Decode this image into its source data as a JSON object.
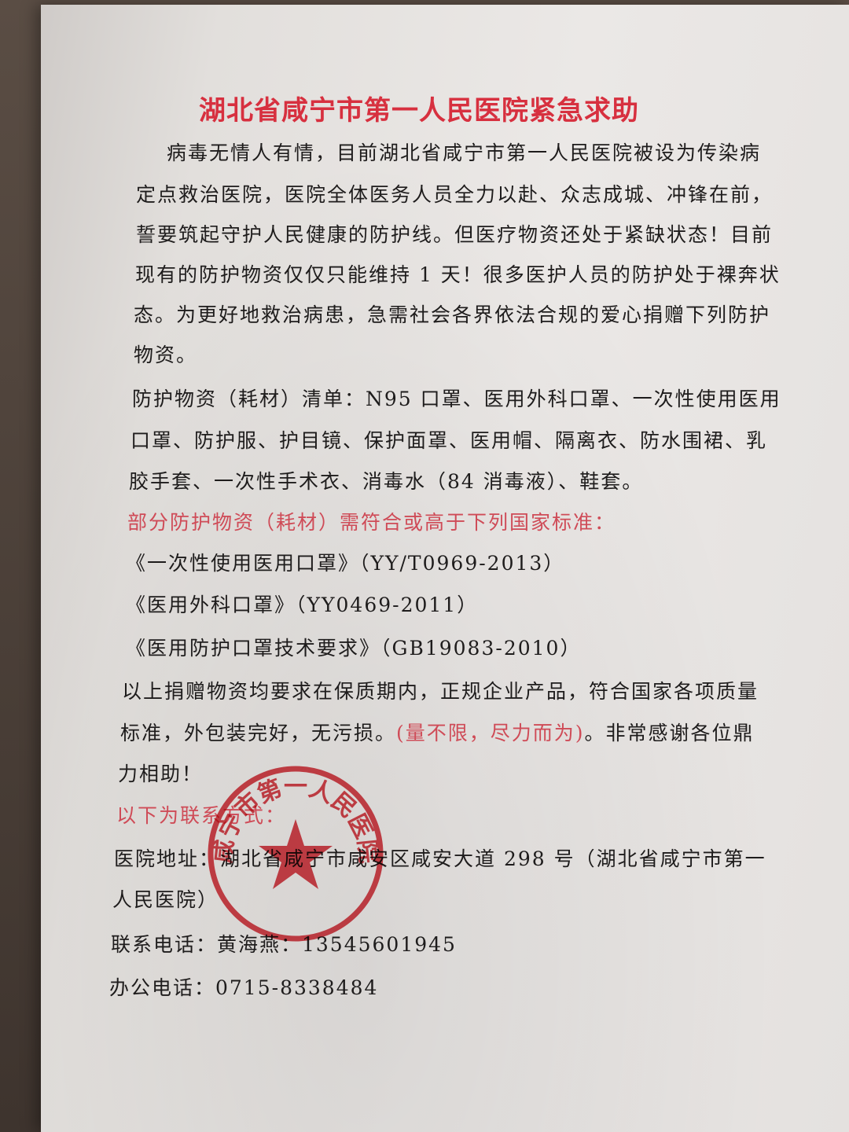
{
  "document": {
    "title": "湖北省咸宁市第一人民医院紧急求助",
    "intro_lines": [
      "病毒无情人有情，目前湖北省咸宁市第一人民医院被设为传染病",
      "定点救治医院，医院全体医务人员全力以赴、众志成城、冲锋在前，",
      "誓要筑起守护人民健康的防护线。但医疗物资还处于紧缺状态！目前",
      "现有的防护物资仅仅只能维持 1 天！很多医护人员的防护处于裸奔状",
      "态。为更好地救治病患，急需社会各界依法合规的爱心捐赠下列防护",
      "物资。"
    ],
    "list_lines": [
      "防护物资（耗材）清单：N95 口罩、医用外科口罩、一次性使用医用",
      "口罩、防护服、护目镜、保护面罩、医用帽、隔离衣、防水围裙、乳",
      "胶手套、一次性手术衣、消毒水（84 消毒液）、鞋套。"
    ],
    "standards_heading": "部分防护物资（耗材）需符合或高于下列国家标准：",
    "standards": [
      "《一次性使用医用口罩》（YY/T0969-2013）",
      "《医用外科口罩》（YY0469-2011）",
      "《医用防护口罩技术要求》（GB19083-2010）"
    ],
    "requirements_line1": "以上捐赠物资均要求在保质期内，正规企业产品，符合国家各项质量",
    "requirements_line2_a": "标准，外包装完好，无污损。",
    "requirements_line2_b": "(量不限，尽力而为)",
    "requirements_line2_c": "。非常感谢各位鼎",
    "requirements_line3": "力相助！",
    "contact_heading": "以下为联系方式：",
    "address_line1": "医院地址：湖北省咸宁市咸安区咸安大道 298 号（湖北省咸宁市第一",
    "address_line2": "人民医院）",
    "phone_contact": "联系电话：黄海燕：13545601945",
    "office_phone": "办公电话：0715-8338484"
  },
  "seal": {
    "text": "咸宁市第一人民医院",
    "color": "#d9323c"
  }
}
